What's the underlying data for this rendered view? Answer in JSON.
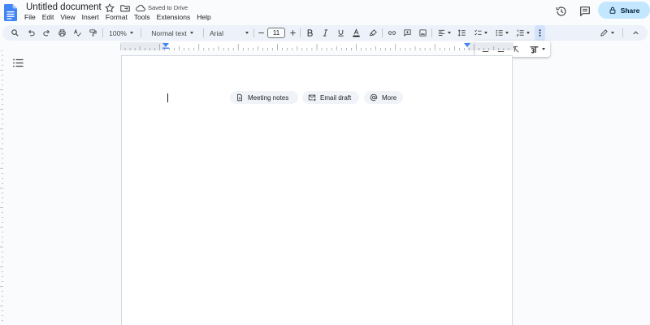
{
  "document": {
    "title": "Untitled document",
    "save_status": "Saved to Drive"
  },
  "menu": [
    {
      "label": "File"
    },
    {
      "label": "Edit"
    },
    {
      "label": "View"
    },
    {
      "label": "Insert"
    },
    {
      "label": "Format"
    },
    {
      "label": "Tools"
    },
    {
      "label": "Extensions"
    },
    {
      "label": "Help"
    }
  ],
  "header": {
    "share_label": "Share"
  },
  "toolbar": {
    "zoom": "100%",
    "paragraph_style": "Normal text",
    "font_family": "Arial",
    "font_size": "11"
  },
  "overflow_toolbar": {
    "icons": [
      "decrease-indent-icon",
      "increase-indent-icon",
      "clear-formatting-icon",
      "input-tools-icon"
    ]
  },
  "smart_chips": [
    {
      "label": "Meeting notes",
      "icon": "document-icon"
    },
    {
      "label": "Email draft",
      "icon": "email-draft-icon"
    },
    {
      "label": "More",
      "icon": "at-sign-icon"
    }
  ],
  "colors": {
    "accent": "#0b57d0",
    "share_button_bg": "#c2e7ff",
    "toolbar_bg": "#edf2fa",
    "page_bg": "#ffffff",
    "app_bg": "#f9fbfd",
    "text_color_swatch": "#000000"
  }
}
